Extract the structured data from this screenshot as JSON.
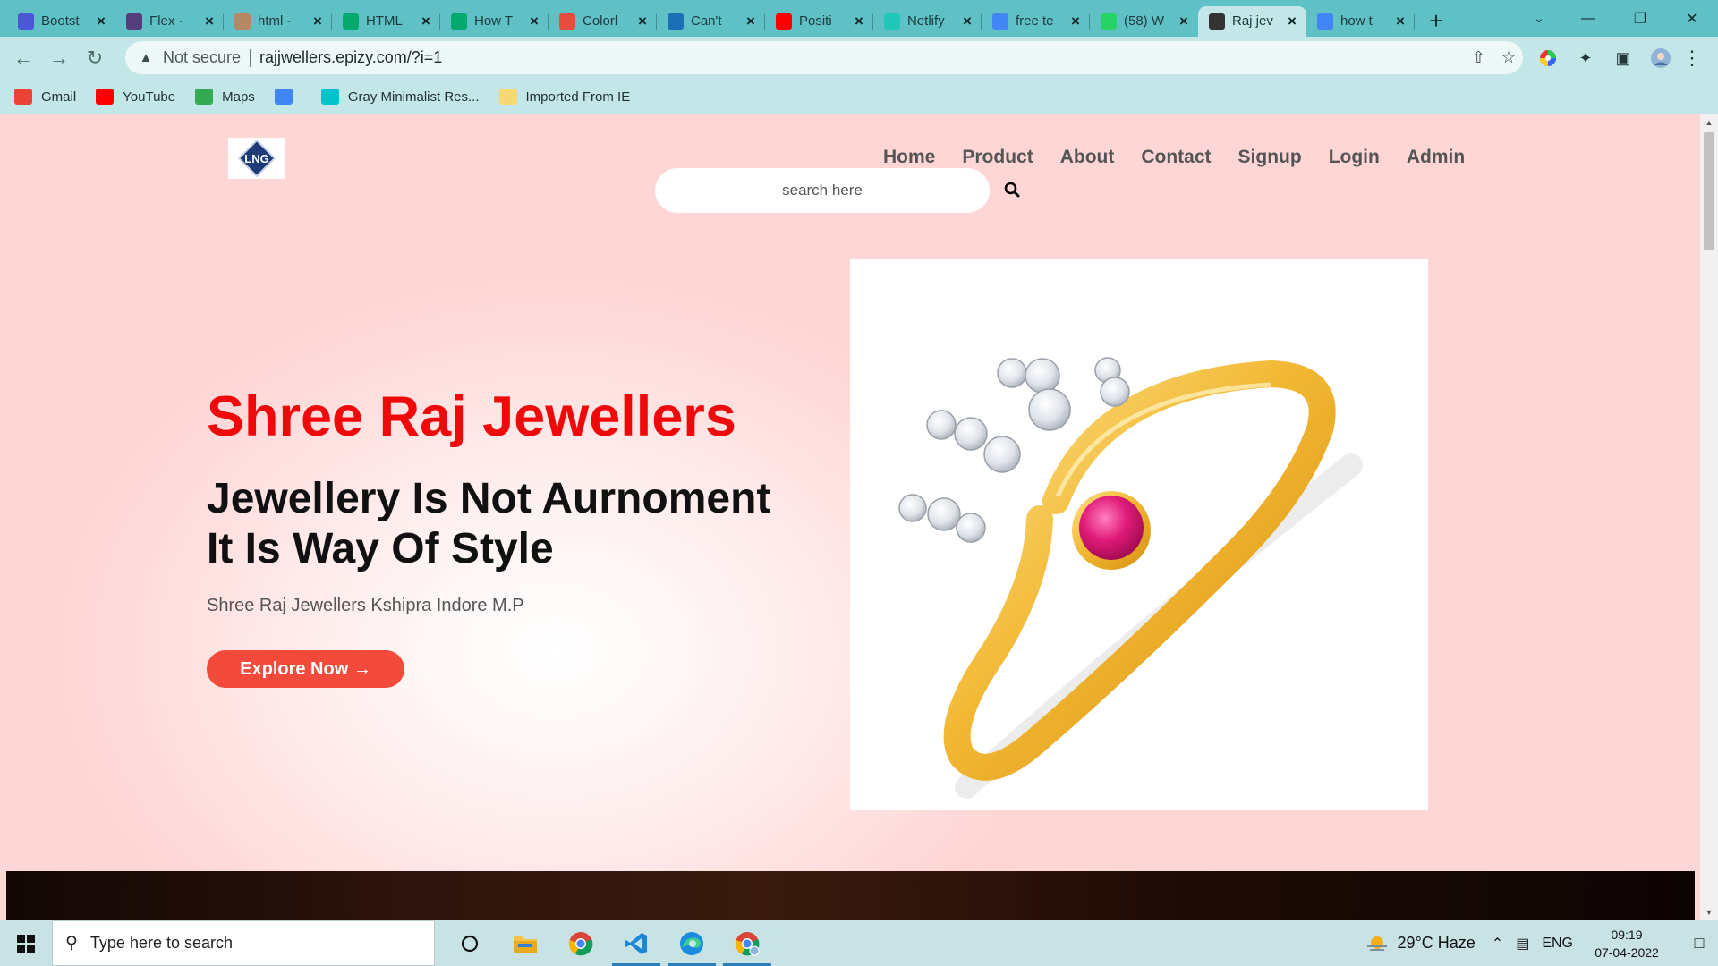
{
  "browser": {
    "tabs": [
      {
        "title": "Bootst",
        "icon": "bootstrap-icon",
        "color": "#4b57d6"
      },
      {
        "title": "Flex ·",
        "icon": "bootstrap-b-icon",
        "color": "#563d7c"
      },
      {
        "title": "html -",
        "icon": "stack-icon",
        "color": "#b58863"
      },
      {
        "title": "HTML",
        "icon": "w3schools-icon",
        "color": "#04aa6d"
      },
      {
        "title": "How T",
        "icon": "w3schools-icon",
        "color": "#04aa6d"
      },
      {
        "title": "Colorl",
        "icon": "colorlib-icon",
        "color": "#e94b3c"
      },
      {
        "title": "Can't",
        "icon": "monitor-icon",
        "color": "#1c6fb5"
      },
      {
        "title": "Positi",
        "icon": "youtube-icon",
        "color": "#ff0000"
      },
      {
        "title": "Netlify",
        "icon": "netlify-icon",
        "color": "#20c6b7"
      },
      {
        "title": "free te",
        "icon": "google-icon",
        "color": "#4285f4"
      },
      {
        "title": "(58) W",
        "icon": "whatsapp-icon",
        "color": "#25d366"
      },
      {
        "title": "Raj jev",
        "icon": "globe-icon",
        "color": "#333333"
      },
      {
        "title": "how t",
        "icon": "google-icon",
        "color": "#4285f4"
      }
    ],
    "active_tab_index": 11,
    "security_label": "Not secure",
    "url": "rajjwellers.epizy.com/?i=1",
    "bookmarks": [
      {
        "label": "Gmail",
        "icon": "gmail-icon"
      },
      {
        "label": "YouTube",
        "icon": "youtube-icon"
      },
      {
        "label": "Maps",
        "icon": "maps-icon"
      },
      {
        "label": "",
        "icon": "chrome-icon"
      },
      {
        "label": "Gray Minimalist Res...",
        "icon": "canva-icon"
      },
      {
        "label": "Imported From IE",
        "icon": "folder-icon"
      }
    ]
  },
  "site": {
    "logo_text": "LNG",
    "nav": [
      "Home",
      "Product",
      "About",
      "Contact",
      "Signup",
      "Login",
      "Admin"
    ],
    "search_placeholder": "search here",
    "hero": {
      "title": "Shree Raj Jewellers",
      "subtitle_line1": "Jewellery Is Not Aurnoment",
      "subtitle_line2": "It Is Way Of Style",
      "location": "Shree Raj Jewellers Kshipra Indore M.P",
      "cta": "Explore Now →"
    },
    "colors": {
      "title_red": "#ee0a0a",
      "cta_bg": "#f44a3b",
      "page_bg": "#ffd6d6"
    }
  },
  "taskbar": {
    "search_placeholder": "Type here to search",
    "weather": "29°C  Haze",
    "language": "ENG",
    "time": "09:19",
    "date": "07-04-2022"
  }
}
